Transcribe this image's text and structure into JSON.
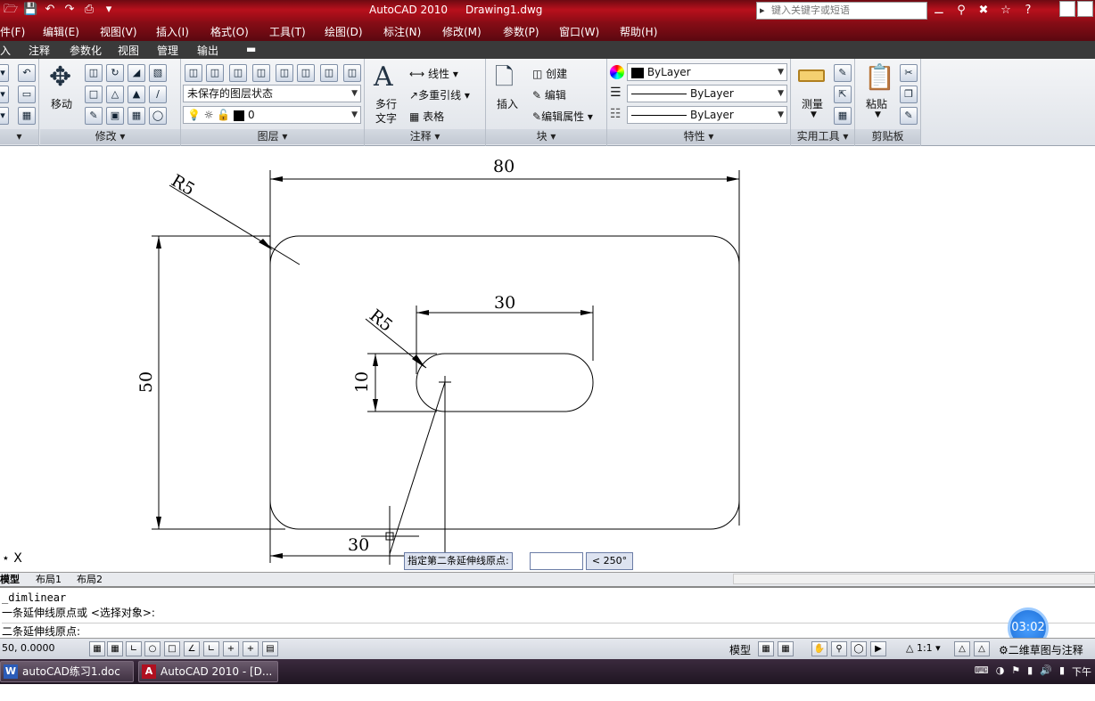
{
  "titlebar": {
    "app_title": "AutoCAD 2010",
    "doc_title": "Drawing1.dwg",
    "search_placeholder": "键入关键字或短语",
    "quick_access": [
      "open-icon",
      "save-icon",
      "undo-icon",
      "redo-icon",
      "plot-icon",
      "dropdown-icon"
    ]
  },
  "menubar": {
    "items": [
      "件(F)",
      "编辑(E)",
      "视图(V)",
      "插入(I)",
      "格式(O)",
      "工具(T)",
      "绘图(D)",
      "标注(N)",
      "修改(M)",
      "参数(P)",
      "窗口(W)",
      "帮助(H)"
    ]
  },
  "tabs": {
    "items": [
      "入",
      "注释",
      "参数化",
      "视图",
      "管理",
      "输出"
    ]
  },
  "ribbon": {
    "modify": {
      "label": "修改",
      "move": "移动"
    },
    "layers": {
      "label": "图层",
      "state": "未保存的图层状态",
      "current": "0"
    },
    "annotation": {
      "label": "注释",
      "mtext": "多行",
      "mtext2": "文字",
      "linear": "线性",
      "mleader": "多重引线",
      "table": "表格"
    },
    "block": {
      "label": "块",
      "insert": "插入",
      "create": "创建",
      "edit": "编辑",
      "edit_attr": "编辑属性"
    },
    "properties": {
      "label": "特性",
      "color": "ByLayer",
      "linetype": "ByLayer",
      "lineweight": "ByLayer"
    },
    "utilities": {
      "label": "实用工具",
      "measure": "测量"
    },
    "clipboard": {
      "label": "剪贴板",
      "paste": "粘贴"
    }
  },
  "drawing": {
    "dim_width": "80",
    "dim_height": "50",
    "dim_slot_len": "30",
    "dim_slot_h": "10",
    "dim_offset": "30",
    "radius_outer": "R5",
    "radius_slot": "R5",
    "ucs_x": "X"
  },
  "dynamic_input": {
    "prompt": "指定第二条延伸线原点:",
    "value": "",
    "angle": "< 250°"
  },
  "layout_tabs": [
    "模型",
    "布局1",
    "布局2"
  ],
  "command": {
    "line1": "_dimlinear",
    "line2": "一条延伸线原点或 <选择对象>:",
    "line3": "二条延伸线原点:"
  },
  "timer": "03:02",
  "statusbar": {
    "coords": "50, 0.0000",
    "model": "模型",
    "scale": "1:1",
    "workspace": "二维草图与注释"
  },
  "taskbar": {
    "items": [
      {
        "icon": "W",
        "label": "autoCAD练习1.doc ..."
      },
      {
        "icon": "A",
        "label": "AutoCAD 2010 - [D..."
      }
    ],
    "clock": "下午"
  }
}
